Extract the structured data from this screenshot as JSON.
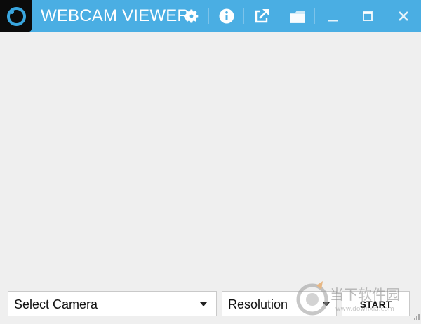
{
  "app": {
    "title": "WEBCAM VIEWER"
  },
  "titlebar": {
    "buttons": [
      {
        "name": "settings",
        "icon": "gear-icon"
      },
      {
        "name": "about",
        "icon": "info-icon"
      },
      {
        "name": "popout",
        "icon": "external-link-icon"
      },
      {
        "name": "folder",
        "icon": "folder-icon"
      },
      {
        "name": "minimize",
        "icon": "minimize-icon"
      },
      {
        "name": "maximize",
        "icon": "maximize-icon"
      },
      {
        "name": "close",
        "icon": "close-icon"
      }
    ],
    "color": "#4aaee3"
  },
  "controls": {
    "camera_select": {
      "value": "Select Camera"
    },
    "resolution_select": {
      "value": "Resolution"
    },
    "start_label": "START"
  },
  "watermark": {
    "text": "当下软件园",
    "subtext": "www.downxia.com"
  }
}
